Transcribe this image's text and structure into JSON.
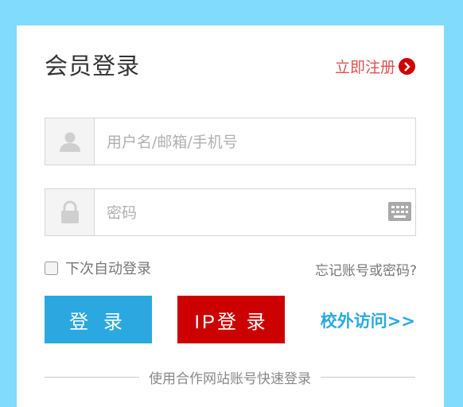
{
  "header": {
    "title": "会员登录",
    "register_label": "立即注册",
    "register_icon": "chevron-right-circle-icon"
  },
  "form": {
    "username": {
      "placeholder": "用户名/邮箱/手机号",
      "value": "",
      "icon": "user-icon"
    },
    "password": {
      "placeholder": "密码",
      "value": "",
      "icon": "lock-icon",
      "keyboard_icon": "keyboard-icon"
    },
    "remember_label": "下次自动登录",
    "remember_checked": false,
    "forgot_label": "忘记账号或密码?"
  },
  "actions": {
    "login_label": "登 录",
    "ip_login_label": "IP登 录",
    "offsite_label": "校外访问>>"
  },
  "footer": {
    "divider_text": "使用合作网站账号快速登录"
  },
  "colors": {
    "background": "#80dbfc",
    "primary_blue": "#2ba8e0",
    "primary_red": "#cc0000",
    "register_text": "#d9534f"
  }
}
